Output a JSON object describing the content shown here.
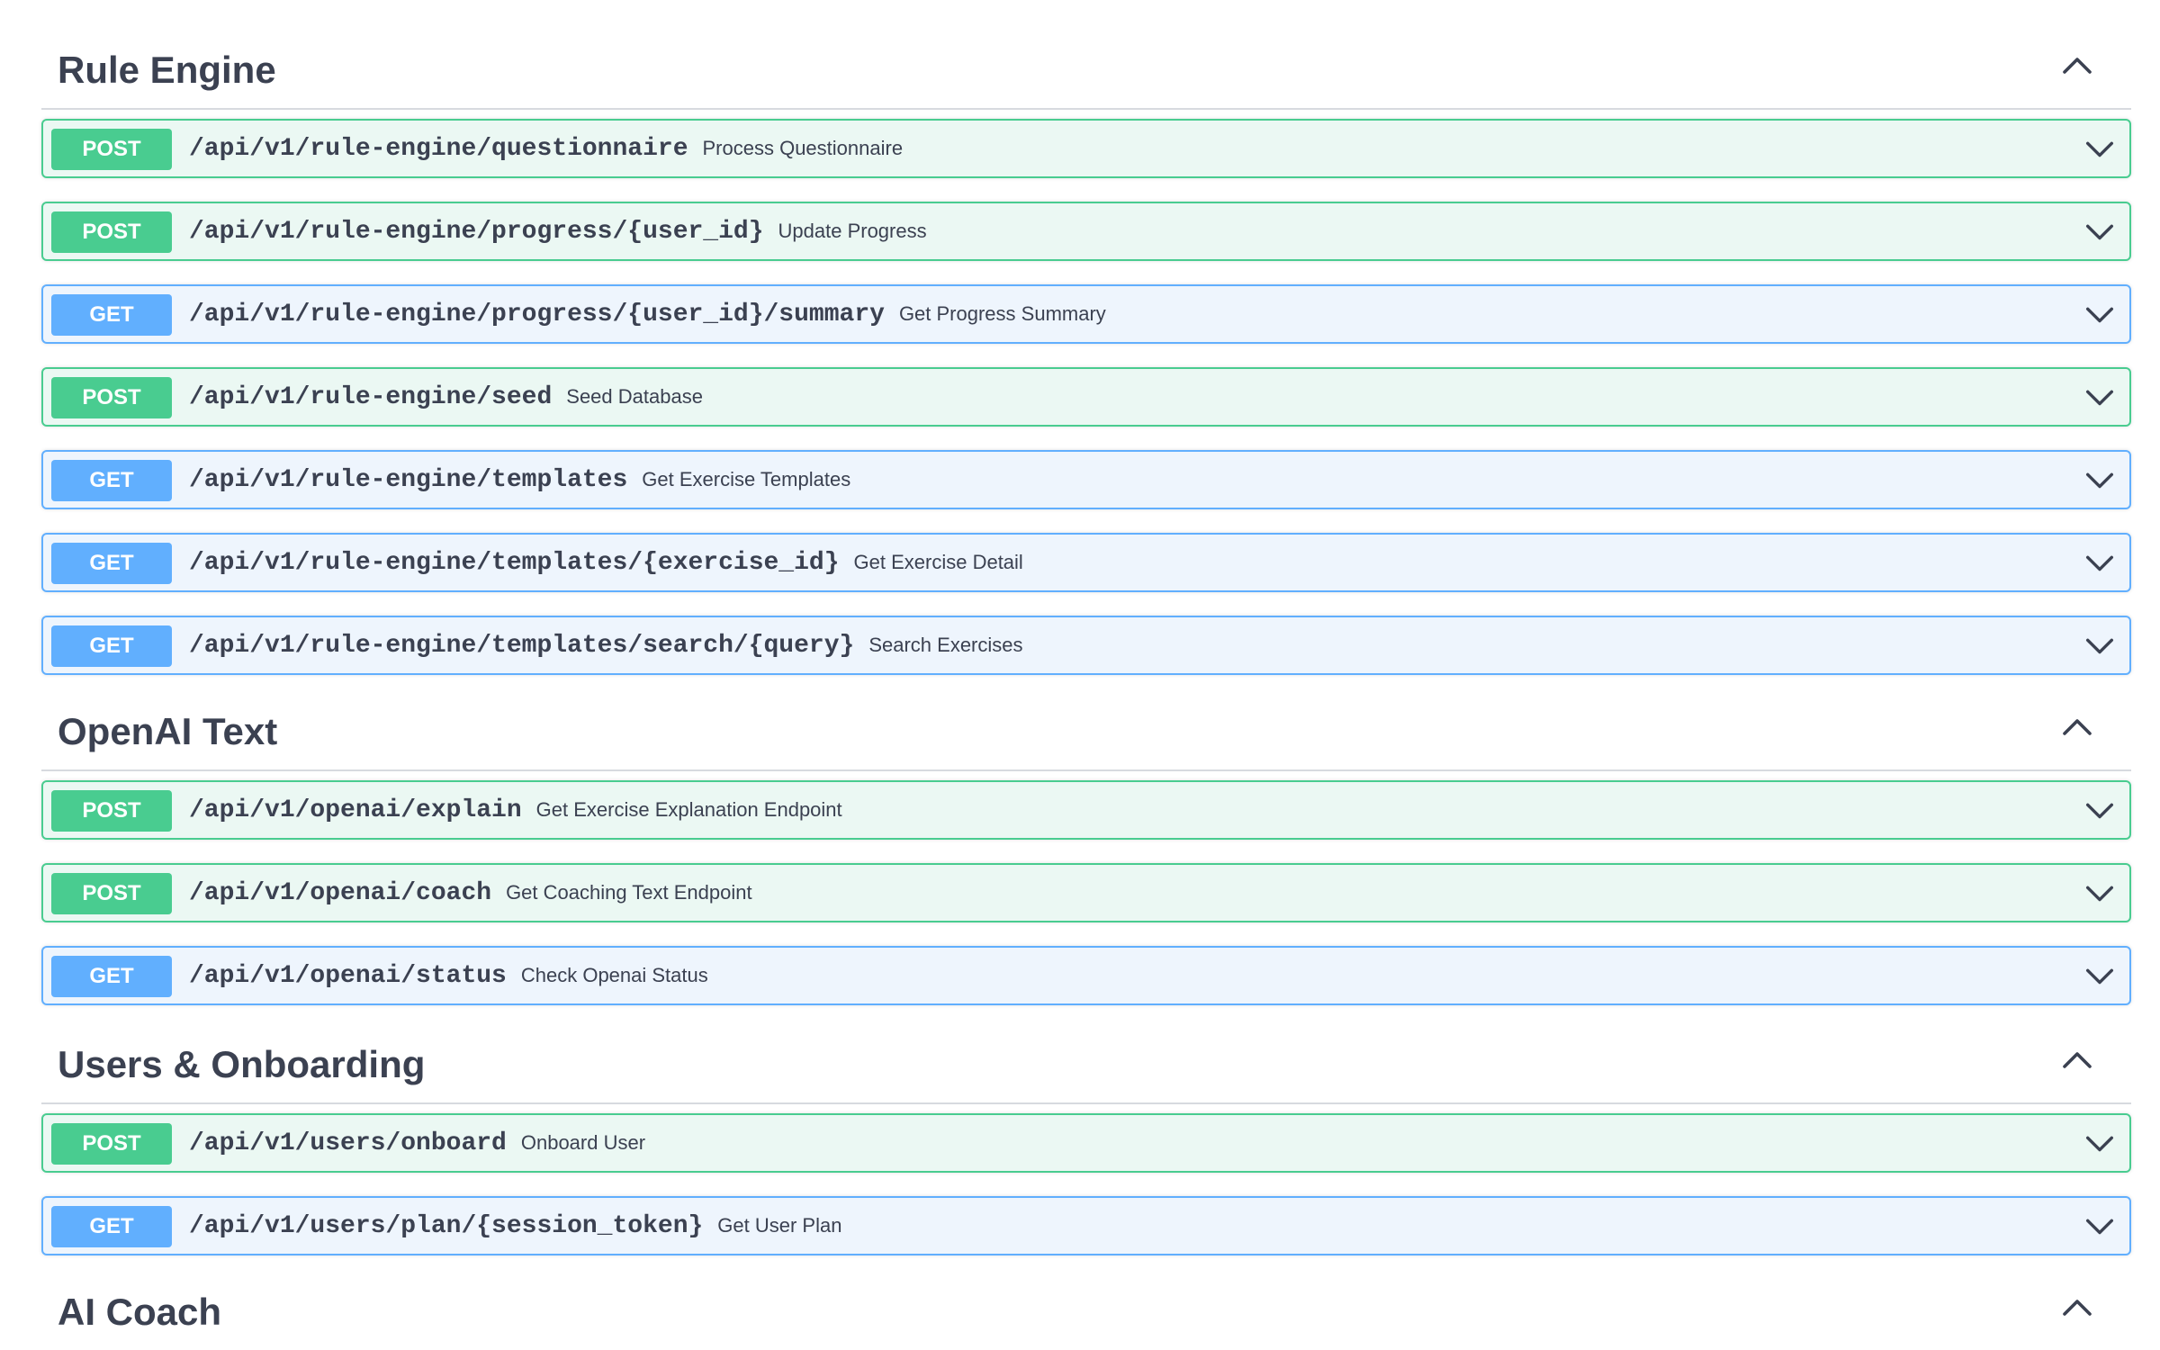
{
  "sections": [
    {
      "title": "Rule Engine",
      "operations": [
        {
          "method": "POST",
          "path": "/api/v1/rule-engine/questionnaire",
          "summary": "Process Questionnaire"
        },
        {
          "method": "POST",
          "path": "/api/v1/rule-engine/progress/{user_id}",
          "summary": "Update Progress"
        },
        {
          "method": "GET",
          "path": "/api/v1/rule-engine/progress/{user_id}/summary",
          "summary": "Get Progress Summary"
        },
        {
          "method": "POST",
          "path": "/api/v1/rule-engine/seed",
          "summary": "Seed Database"
        },
        {
          "method": "GET",
          "path": "/api/v1/rule-engine/templates",
          "summary": "Get Exercise Templates"
        },
        {
          "method": "GET",
          "path": "/api/v1/rule-engine/templates/{exercise_id}",
          "summary": "Get Exercise Detail"
        },
        {
          "method": "GET",
          "path": "/api/v1/rule-engine/templates/search/{query}",
          "summary": "Search Exercises"
        }
      ]
    },
    {
      "title": "OpenAI Text",
      "operations": [
        {
          "method": "POST",
          "path": "/api/v1/openai/explain",
          "summary": "Get Exercise Explanation Endpoint"
        },
        {
          "method": "POST",
          "path": "/api/v1/openai/coach",
          "summary": "Get Coaching Text Endpoint"
        },
        {
          "method": "GET",
          "path": "/api/v1/openai/status",
          "summary": "Check Openai Status"
        }
      ]
    },
    {
      "title": "Users & Onboarding",
      "operations": [
        {
          "method": "POST",
          "path": "/api/v1/users/onboard",
          "summary": "Onboard User"
        },
        {
          "method": "GET",
          "path": "/api/v1/users/plan/{session_token}",
          "summary": "Get User Plan"
        }
      ]
    },
    {
      "title": "AI Coach",
      "operations": []
    }
  ],
  "icons": {
    "section_toggle": "chevron-up-icon",
    "operation_toggle": "chevron-down-icon"
  },
  "colors": {
    "post_accent": "#49cc90",
    "post_background": "#ebf8f3",
    "get_accent": "#61affe",
    "get_background": "#eef5fd",
    "text": "#3b4151"
  }
}
